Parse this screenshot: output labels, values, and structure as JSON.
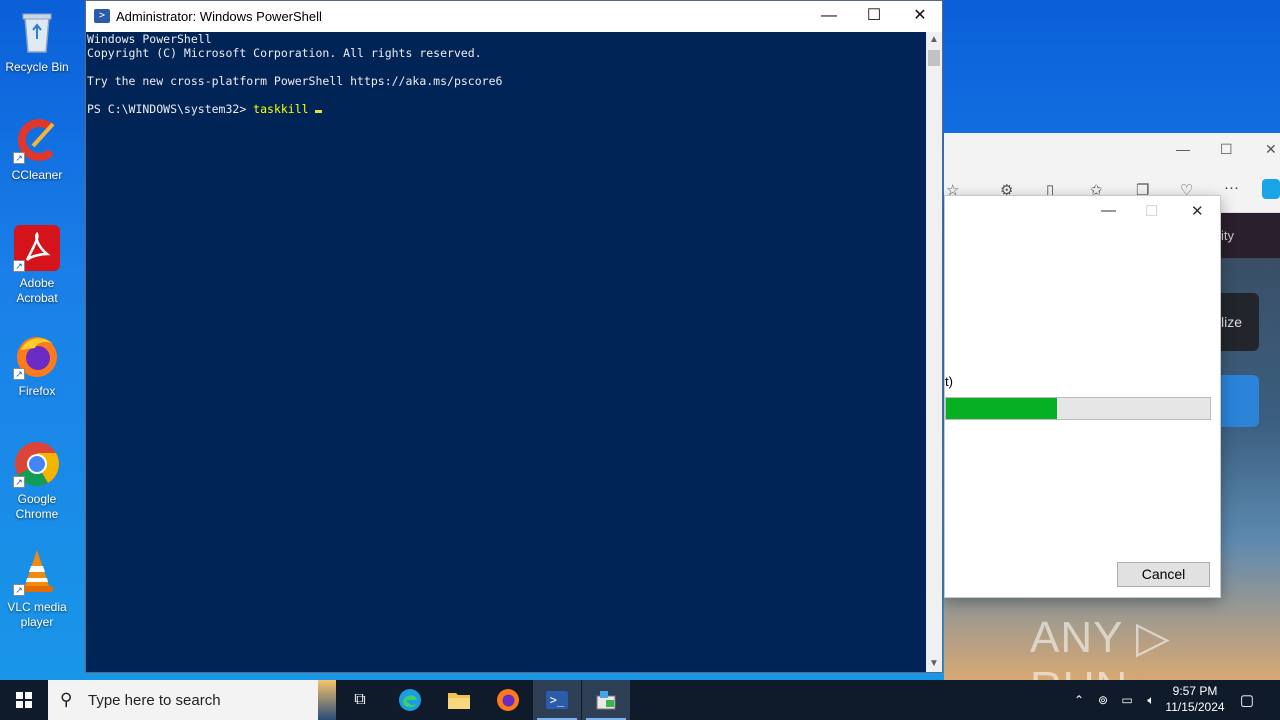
{
  "desktop": {
    "icons": [
      {
        "label": "Recycle Bin"
      },
      {
        "label": "CCleaner"
      },
      {
        "label": "Adobe Acrobat"
      },
      {
        "label": "Firefox"
      },
      {
        "label": "Google Chrome"
      },
      {
        "label": "VLC media player"
      }
    ]
  },
  "powershell": {
    "title": "Administrator: Windows PowerShell",
    "lines": [
      "Windows PowerShell",
      "Copyright (C) Microsoft Corporation. All rights reserved.",
      "",
      "Try the new cross-platform PowerShell https://aka.ms/pscore6",
      ""
    ],
    "prompt": "PS C:\\WINDOWS\\system32> ",
    "command": "taskkill "
  },
  "dialog": {
    "partial_label": "t)",
    "progress_fraction": 0.42,
    "cancel_label": "Cancel"
  },
  "browser": {
    "partial_tab": "ity",
    "partial_button": "lize"
  },
  "watermark": "ANY ▷ RUN",
  "taskbar": {
    "search_placeholder": "Type here to search",
    "time": "9:57 PM",
    "date": "11/15/2024"
  }
}
